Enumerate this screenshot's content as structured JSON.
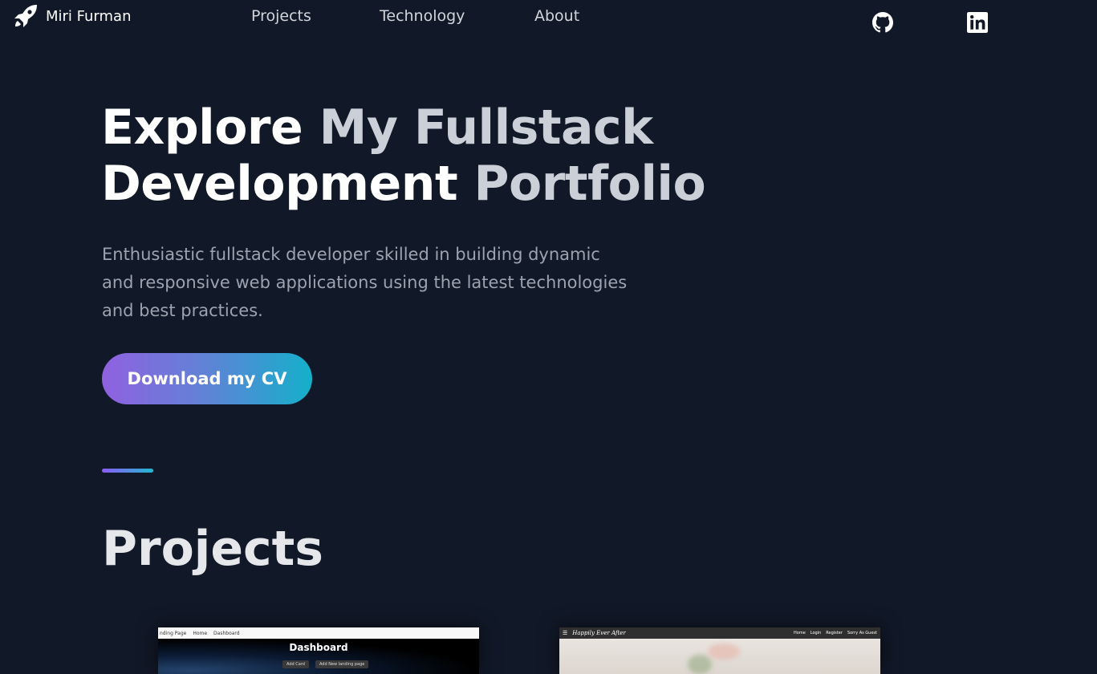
{
  "nav": {
    "brand": "Miri Furman",
    "links": [
      "Projects",
      "Technology",
      "About"
    ],
    "social": [
      "github-icon",
      "linkedin-icon"
    ]
  },
  "hero": {
    "title_line1_a": "Explore ",
    "title_line1_b": "My Fullstack",
    "title_line2_a": "Development ",
    "title_line2_b": "Portfolio",
    "desc_lines": [
      "Enthusiastic fullstack developer skilled in building dynamic",
      "and responsive web applications using the latest technologies",
      "and best practices."
    ],
    "cta": "Download my CV"
  },
  "projects": {
    "title": "Projects",
    "cards": [
      {
        "nav_left": "nding Page",
        "nav_links": [
          "Home",
          "Dashboard"
        ],
        "title": "Dashboard",
        "buttons": [
          "Add Card",
          "Add New landing page"
        ]
      },
      {
        "logo": "Happily Ever After",
        "nav_links": [
          "Home",
          "Login",
          "Register",
          "Sorry As Guest"
        ]
      }
    ]
  },
  "colors": {
    "background": "#111827",
    "accent_start": "#9061e0",
    "accent_end": "#14b0ca"
  }
}
